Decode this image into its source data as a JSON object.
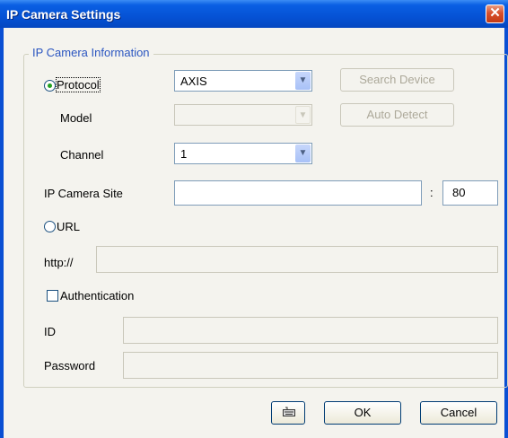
{
  "window": {
    "title": "IP Camera Settings",
    "close_glyph": "✕"
  },
  "group": {
    "legend": "IP Camera Information"
  },
  "protocol": {
    "label": "Protocol",
    "value": "AXIS",
    "selected": true
  },
  "search_device": {
    "label": "Search Device"
  },
  "model": {
    "label": "Model",
    "value": ""
  },
  "auto_detect": {
    "label": "Auto Detect"
  },
  "channel": {
    "label": "Channel",
    "value": "1"
  },
  "ip_site": {
    "label": "IP Camera Site",
    "value": "",
    "separator": ":",
    "port": "80"
  },
  "url": {
    "label": "URL",
    "selected": false,
    "prefix": "http://",
    "value": ""
  },
  "auth": {
    "label": "Authentication",
    "checked": false
  },
  "id": {
    "label": "ID",
    "value": ""
  },
  "password": {
    "label": "Password",
    "value": ""
  },
  "footer": {
    "keyboard_icon": "keyboard-icon",
    "ok": "OK",
    "cancel": "Cancel"
  },
  "colors": {
    "titlebar": "#0552d5",
    "frame": "#0a4fd3",
    "legend": "#2a55c0",
    "close": "#d8502c"
  }
}
